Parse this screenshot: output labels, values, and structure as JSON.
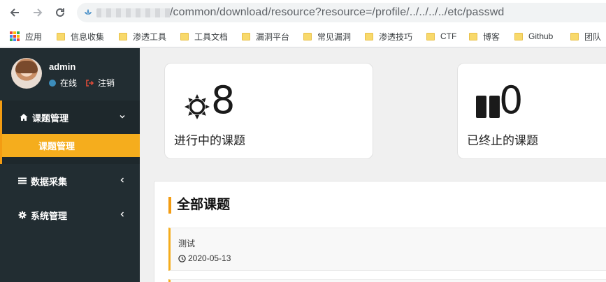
{
  "browser": {
    "url": "/common/download/resource?resource=/profile/../../../../etc/passwd",
    "bookmarks": [
      {
        "label": "应用",
        "type": "apps"
      },
      {
        "label": "信息收集",
        "type": "folder"
      },
      {
        "label": "渗透工具",
        "type": "folder"
      },
      {
        "label": "工具文档",
        "type": "folder"
      },
      {
        "label": "漏洞平台",
        "type": "folder"
      },
      {
        "label": "常见漏洞",
        "type": "folder"
      },
      {
        "label": "渗透技巧",
        "type": "folder"
      },
      {
        "label": "CTF",
        "type": "folder"
      },
      {
        "label": "博客",
        "type": "folder"
      },
      {
        "label": "Github",
        "type": "folder"
      },
      {
        "label": "团队",
        "type": "folder"
      }
    ]
  },
  "user": {
    "name": "admin",
    "status": "在线",
    "logout": "注销",
    "status_color": "#3c8dbc"
  },
  "sidebar": {
    "menu": [
      {
        "label": "课题管理",
        "icon": "home-icon",
        "expanded": true
      },
      {
        "label": "数据采集",
        "icon": "list-icon",
        "expanded": false
      },
      {
        "label": "系统管理",
        "icon": "gear-icon",
        "expanded": false
      }
    ],
    "submenu": [
      {
        "label": "课题管理",
        "active": true
      }
    ],
    "accent": "#f39c12"
  },
  "stats": [
    {
      "value": "8",
      "label": "进行中的课题",
      "icon": "sun-icon"
    },
    {
      "value": "0",
      "label": "已终止的课题",
      "icon": "pause-icon"
    }
  ],
  "tasks_panel": {
    "title": "全部课题",
    "items": [
      {
        "title": "测试",
        "date": "2020-05-13"
      }
    ]
  }
}
